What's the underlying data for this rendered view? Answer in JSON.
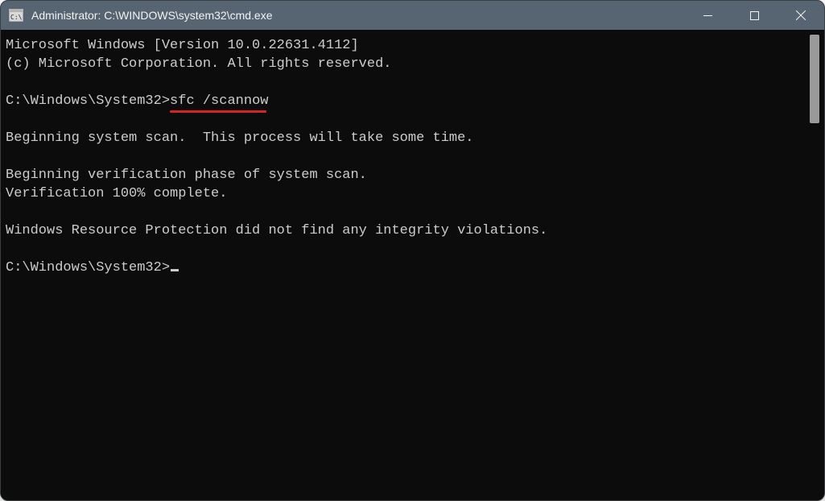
{
  "window": {
    "title": "Administrator: C:\\WINDOWS\\system32\\cmd.exe"
  },
  "terminal": {
    "lines": {
      "version": "Microsoft Windows [Version 10.0.22631.4112]",
      "copyright": "(c) Microsoft Corporation. All rights reserved.",
      "prompt1_prefix": "C:\\Windows\\System32>",
      "prompt1_cmd": "sfc /scannow",
      "begin_scan": "Beginning system scan.  This process will take some time.",
      "begin_verify": "Beginning verification phase of system scan.",
      "verify_complete": "Verification 100% complete.",
      "wrp_result": "Windows Resource Protection did not find any integrity violations.",
      "prompt2": "C:\\Windows\\System32>"
    }
  },
  "icons": {
    "app": "cmd-icon",
    "minimize": "minimize-icon",
    "maximize": "maximize-icon",
    "close": "close-icon"
  }
}
